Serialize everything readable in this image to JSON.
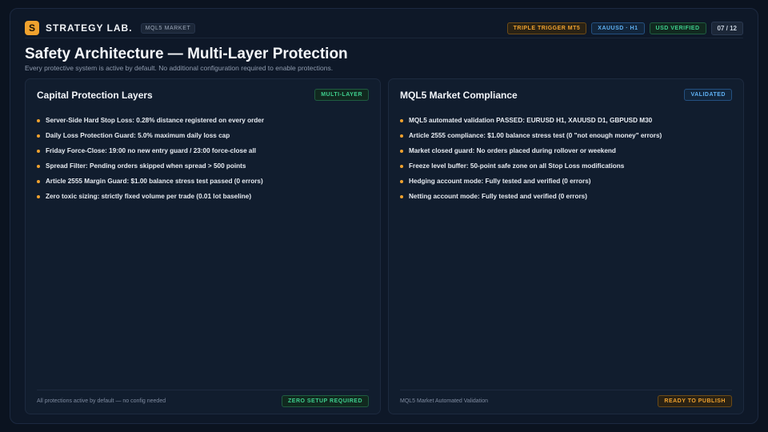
{
  "header": {
    "logo_letter": "S",
    "brand": "STRATEGY LAB.",
    "brand_tag": "MQL5 MARKET",
    "badges": [
      "TRIPLE TRIGGER MT5",
      "XAUUSD · H1",
      "USD VERIFIED"
    ],
    "page": "07 / 12"
  },
  "page_title": "Safety Architecture — Multi-Layer Protection",
  "page_subtitle": "Every protective system is active by default. No additional configuration required to enable protections.",
  "left_panel": {
    "title": "Capital Protection Layers",
    "badge": "MULTI-LAYER",
    "items": [
      "Server-Side Hard Stop Loss: 0.28% distance registered on every order",
      "Daily Loss Protection Guard: 5.0% maximum daily loss cap",
      "Friday Force-Close: 19:00 no new entry guard / 23:00 force-close all",
      "Spread Filter: Pending orders skipped when spread > 500 points",
      "Article 2555 Margin Guard: $1.00 balance stress test passed (0 errors)",
      "Zero toxic sizing: strictly fixed volume per trade (0.01 lot baseline)"
    ],
    "footer_text": "All protections active by default — no config needed",
    "footer_badge": "ZERO SETUP REQUIRED"
  },
  "right_panel": {
    "title": "MQL5 Market Compliance",
    "badge": "VALIDATED",
    "items": [
      "MQL5 automated validation PASSED: EURUSD H1, XAUUSD D1, GBPUSD M30",
      "Article 2555 compliance: $1.00 balance stress test (0 \"not enough money\" errors)",
      "Market closed guard: No orders placed during rollover or weekend",
      "Freeze level buffer: 50-point safe zone on all Stop Loss modifications",
      "Hedging account mode: Fully tested and verified (0 errors)",
      "Netting account mode: Fully tested and verified (0 errors)"
    ],
    "footer_text": "MQL5 Market Automated Validation",
    "footer_badge": "READY TO PUBLISH"
  },
  "colors": {
    "accent_orange": "#f0a22e",
    "accent_blue": "#5fb0f2",
    "accent_green": "#3ecf8e",
    "background": "#0b1320"
  }
}
